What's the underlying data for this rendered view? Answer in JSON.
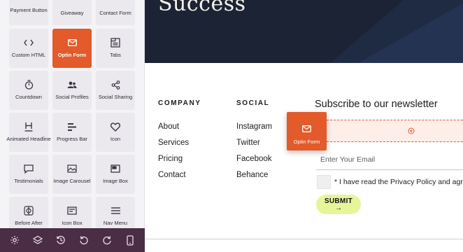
{
  "sidebar": {
    "blocks": [
      {
        "label": "Payment Button",
        "icon": "payment-button-icon"
      },
      {
        "label": "Giveaway",
        "icon": "giveaway-icon"
      },
      {
        "label": "Contact Form",
        "icon": "contact-form-icon"
      },
      {
        "label": "Custom HTML",
        "icon": "code-icon"
      },
      {
        "label": "Optin Form",
        "icon": "envelope-icon",
        "active": true
      },
      {
        "label": "Tabs",
        "icon": "tabs-icon"
      },
      {
        "label": "Countdown",
        "icon": "stopwatch-icon"
      },
      {
        "label": "Social Profiles",
        "icon": "users-icon"
      },
      {
        "label": "Social Sharing",
        "icon": "share-icon"
      },
      {
        "label": "Animated Headline",
        "icon": "heading-icon"
      },
      {
        "label": "Progress Bar",
        "icon": "progress-bar-icon"
      },
      {
        "label": "Icon",
        "icon": "heart-icon"
      },
      {
        "label": "Testimonials",
        "icon": "speech-bubble-icon"
      },
      {
        "label": "Image Carousel",
        "icon": "image-icon"
      },
      {
        "label": "Image Box",
        "icon": "image-box-icon"
      },
      {
        "label": "Before After",
        "icon": "before-after-icon"
      },
      {
        "label": "Icon Box",
        "icon": "icon-box-icon"
      },
      {
        "label": "Nav Menu",
        "icon": "hamburger-icon"
      }
    ],
    "toolbar": [
      "settings-icon",
      "layers-icon",
      "history-icon",
      "undo-icon",
      "redo-icon",
      "mobile-preview-icon"
    ],
    "accent_color": "#e35a2b",
    "toolbar_color": "#4b2d45"
  },
  "preview": {
    "hero_title": "Success",
    "footer": {
      "company_heading": "COMPANY",
      "company_links": [
        "About",
        "Services",
        "Pricing",
        "Contact"
      ],
      "social_heading": "SOCIAL",
      "social_links": [
        "Instagram",
        "Twitter",
        "Facebook",
        "Behance"
      ]
    },
    "newsletter": {
      "title": "Subscribe to our newsletter",
      "email_placeholder": "Enter Your Email",
      "consent_text": "* I have read the Privacy Policy and agree",
      "submit_label": "SUBMIT",
      "submit_arrow": "→",
      "submit_color": "#e6f59a"
    },
    "drag_ghost": {
      "label": "Optin Form",
      "icon": "envelope-icon"
    }
  }
}
